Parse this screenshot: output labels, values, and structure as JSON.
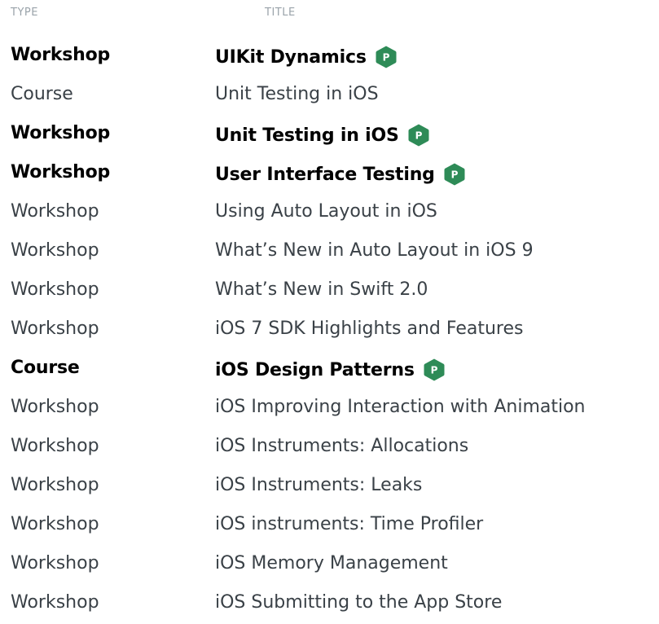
{
  "header": {
    "type_label": "TYPE",
    "title_label": "TITLE"
  },
  "colors": {
    "badge_green": "#2e8b57",
    "badge_text": "#ffffff",
    "header_text": "#9aa3aa",
    "row_text": "#3a4147",
    "featured_text": "#000000"
  },
  "badge": {
    "icon": "pro-badge-icon",
    "letter": "P"
  },
  "rows": [
    {
      "type": "Workshop",
      "title": "UIKit Dynamics",
      "featured": true
    },
    {
      "type": "Course",
      "title": "Unit Testing in iOS",
      "featured": false
    },
    {
      "type": "Workshop",
      "title": "Unit Testing in iOS",
      "featured": true
    },
    {
      "type": "Workshop",
      "title": "User Interface Testing",
      "featured": true
    },
    {
      "type": "Workshop",
      "title": "Using Auto Layout in iOS",
      "featured": false
    },
    {
      "type": "Workshop",
      "title": "What’s New in Auto Layout in iOS 9",
      "featured": false
    },
    {
      "type": "Workshop",
      "title": "What’s New in Swift 2.0",
      "featured": false
    },
    {
      "type": "Workshop",
      "title": "iOS 7 SDK Highlights and Features",
      "featured": false
    },
    {
      "type": "Course",
      "title": "iOS Design Patterns",
      "featured": true
    },
    {
      "type": "Workshop",
      "title": "iOS Improving Interaction with Animation",
      "featured": false
    },
    {
      "type": "Workshop",
      "title": "iOS Instruments: Allocations",
      "featured": false
    },
    {
      "type": "Workshop",
      "title": "iOS Instruments: Leaks",
      "featured": false
    },
    {
      "type": "Workshop",
      "title": "iOS instruments: Time Profiler",
      "featured": false
    },
    {
      "type": "Workshop",
      "title": "iOS Memory Management",
      "featured": false
    },
    {
      "type": "Workshop",
      "title": "iOS Submitting to the App Store",
      "featured": false
    }
  ]
}
